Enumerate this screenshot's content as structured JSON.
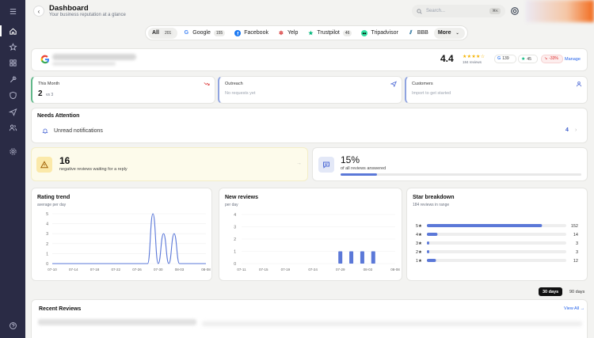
{
  "header": {
    "title": "Dashboard",
    "subtitle": "Your business reputation at a glance",
    "search_placeholder": "Search...",
    "search_shortcut": "⌘K"
  },
  "tabs": [
    {
      "label": "All",
      "count": "201",
      "icon": "none"
    },
    {
      "label": "Google",
      "count": "155",
      "icon": "google-icon"
    },
    {
      "label": "Facebook",
      "count": "",
      "icon": "facebook-icon"
    },
    {
      "label": "Yelp",
      "count": "",
      "icon": "yelp-icon"
    },
    {
      "label": "Trustpilot",
      "count": "46",
      "icon": "trustpilot-icon"
    },
    {
      "label": "Tripadvisor",
      "count": "",
      "icon": "tripadvisor-icon"
    },
    {
      "label": "BBB",
      "count": "",
      "icon": "bbb-icon"
    },
    {
      "label": "More",
      "count": "",
      "icon": "chevron-down-icon"
    }
  ],
  "business": {
    "rating": "4.4",
    "stars": "★★★★☆",
    "review_count": "184 reviews",
    "google_count": "139",
    "trustpilot_count": "45",
    "change": "-33%",
    "manage_label": "Manage"
  },
  "stats": {
    "this_month": {
      "label": "This Month",
      "value": "2",
      "compare": "vs 3"
    },
    "outreach": {
      "label": "Outreach",
      "text": "No requests yet"
    },
    "customers": {
      "label": "Customers",
      "text": "Import to get started"
    }
  },
  "needs_attention": {
    "title": "Needs Attention",
    "item_label": "Unread notifications",
    "item_count": "4"
  },
  "negative": {
    "value": "16",
    "text": "negative reviews waiting for a reply"
  },
  "answered": {
    "value": "15%",
    "text": "of all reviews answered",
    "fraction": 0.15
  },
  "rating_trend": {
    "title": "Rating trend",
    "subtitle": "average per day"
  },
  "new_reviews": {
    "title": "New reviews",
    "subtitle": "per day"
  },
  "star_breakdown": {
    "title": "Star breakdown",
    "subtitle": "184 reviews in range"
  },
  "range": {
    "active": "30 days",
    "inactive": "90 days"
  },
  "recent_reviews": {
    "title": "Recent Reviews",
    "view_all": "View All →"
  },
  "colors": {
    "accent": "#4f6bd6",
    "sidebar": "#2a2b45",
    "line": "#5b78d8"
  },
  "chart_data": [
    {
      "type": "line",
      "title": "Rating trend",
      "subtitle": "average per day",
      "x": [
        "07-10",
        "07-11",
        "07-12",
        "07-13",
        "07-14",
        "07-15",
        "07-16",
        "07-17",
        "07-18",
        "07-19",
        "07-20",
        "07-21",
        "07-22",
        "07-23",
        "07-24",
        "07-25",
        "07-26",
        "07-27",
        "07-28",
        "07-29",
        "07-30",
        "07-31",
        "08-01",
        "08-02",
        "08-03",
        "08-04",
        "08-05",
        "08-06",
        "08-07",
        "08-08"
      ],
      "series": [
        {
          "values": [
            0,
            0,
            0,
            0,
            0,
            0,
            0,
            0,
            0,
            0,
            0,
            0,
            0,
            0,
            0,
            0,
            0,
            0,
            0,
            5,
            0,
            3,
            0,
            3,
            0,
            0,
            0,
            0,
            0,
            0
          ]
        }
      ],
      "xticks": [
        "07-10",
        "07-14",
        "07-18",
        "07-22",
        "07-26",
        "07-30",
        "08-03",
        "08-08"
      ],
      "ylim": [
        0,
        5
      ],
      "yticks": [
        0,
        1,
        2,
        3,
        4,
        5
      ],
      "grid": true
    },
    {
      "type": "bar",
      "title": "New reviews",
      "subtitle": "per day",
      "x": [
        "07-11",
        "07-12",
        "07-13",
        "07-14",
        "07-15",
        "07-16",
        "07-17",
        "07-18",
        "07-19",
        "07-20",
        "07-21",
        "07-22",
        "07-23",
        "07-24",
        "07-25",
        "07-26",
        "07-27",
        "07-28",
        "07-29",
        "07-30",
        "07-31",
        "08-01",
        "08-02",
        "08-03",
        "08-04",
        "08-05",
        "08-06",
        "08-07",
        "08-08"
      ],
      "values": [
        0,
        0,
        0,
        0,
        0,
        0,
        0,
        0,
        0,
        0,
        0,
        0,
        0,
        0,
        0,
        0,
        0,
        0,
        1,
        0,
        1,
        0,
        1,
        0,
        1,
        0,
        0,
        0,
        0
      ],
      "xticks": [
        "07-11",
        "07-15",
        "07-19",
        "07-24",
        "07-29",
        "08-03",
        "08-08"
      ],
      "ylim": [
        0,
        4
      ],
      "yticks": [
        0,
        1,
        2,
        3,
        4
      ],
      "grid": true
    },
    {
      "type": "bar",
      "orientation": "horizontal",
      "title": "Star breakdown",
      "subtitle": "184 reviews in range",
      "categories": [
        "5★",
        "4★",
        "3★",
        "2★",
        "1★"
      ],
      "values": [
        152,
        14,
        3,
        3,
        12
      ],
      "max": 184
    }
  ]
}
